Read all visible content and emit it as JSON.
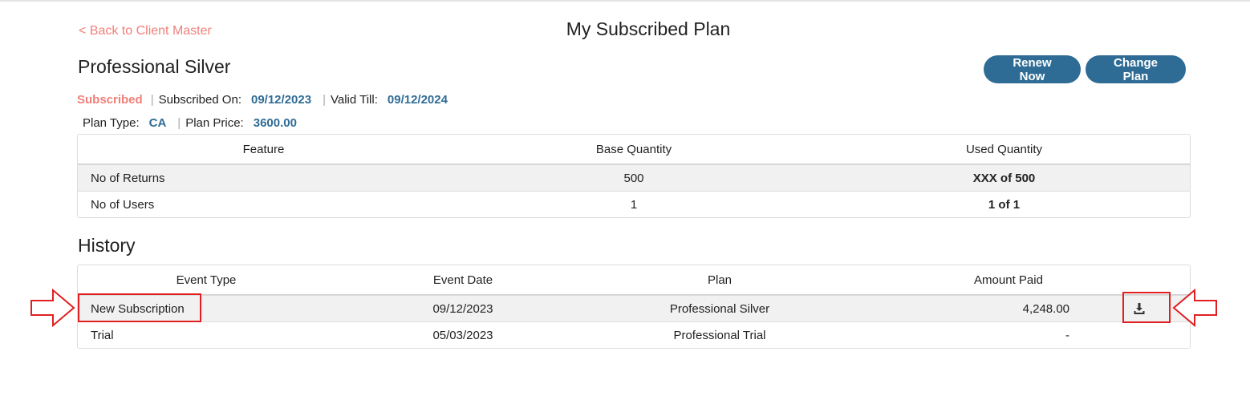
{
  "header": {
    "back_link": "< Back to Client Master",
    "page_title": "My Subscribed Plan"
  },
  "plan": {
    "name": "Professional Silver",
    "status": "Subscribed",
    "subscribed_on_label": "Subscribed On:",
    "subscribed_on": "09/12/2023",
    "valid_till_label": "Valid Till:",
    "valid_till": "09/12/2024",
    "plan_type_label": "Plan Type:",
    "plan_type": "CA",
    "plan_price_label": "Plan Price:",
    "plan_price": "3600.00"
  },
  "actions": {
    "renew_label": "Renew Now",
    "change_label": "Change Plan"
  },
  "features_table": {
    "headers": [
      "Feature",
      "Base Quantity",
      "Used Quantity"
    ],
    "rows": [
      [
        "No of Returns",
        "500",
        "XXX of 500"
      ],
      [
        "No of Users",
        "1",
        "1 of 1"
      ]
    ]
  },
  "history": {
    "title": "History",
    "headers": [
      "Event Type",
      "Event Date",
      "Plan",
      "Amount Paid"
    ],
    "rows": [
      [
        "New Subscription",
        "09/12/2023",
        "Professional Silver",
        "4,248.00"
      ],
      [
        "Trial",
        "05/03/2023",
        "Professional Trial",
        "-"
      ]
    ]
  },
  "icons": {
    "download": "download-icon",
    "annotation_arrows": "arrow-right-outline"
  },
  "colors": {
    "accent": "#2f6c95",
    "status": "#f0807a",
    "highlight": "#e02020"
  }
}
